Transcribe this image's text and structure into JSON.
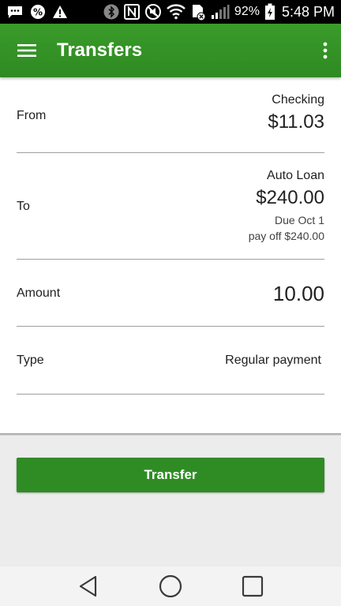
{
  "status_bar": {
    "icons": [
      "message-icon",
      "percent-icon",
      "warning-icon",
      "bluetooth-icon",
      "nfc-icon",
      "mute-icon",
      "wifi-icon",
      "sim-error-icon",
      "signal-icon",
      "battery-charging-icon"
    ],
    "battery_percent": "92%",
    "time": "5:48 PM"
  },
  "app_bar": {
    "title": "Transfers",
    "menu_icon": "hamburger-menu-icon",
    "overflow_icon": "more-vert-icon"
  },
  "form": {
    "from": {
      "label": "From",
      "account_name": "Checking",
      "balance": "$11.03"
    },
    "to": {
      "label": "To",
      "account_name": "Auto Loan",
      "balance": "$240.00",
      "due": "Due Oct 1",
      "payoff": "pay off $240.00"
    },
    "amount": {
      "label": "Amount",
      "value": "10.00"
    },
    "type": {
      "label": "Type",
      "value": "Regular payment"
    }
  },
  "actions": {
    "transfer_label": "Transfer",
    "accent_color": "#2f8c25"
  },
  "nav_bar": {
    "icons": [
      "back-icon",
      "home-icon",
      "recents-icon"
    ]
  }
}
